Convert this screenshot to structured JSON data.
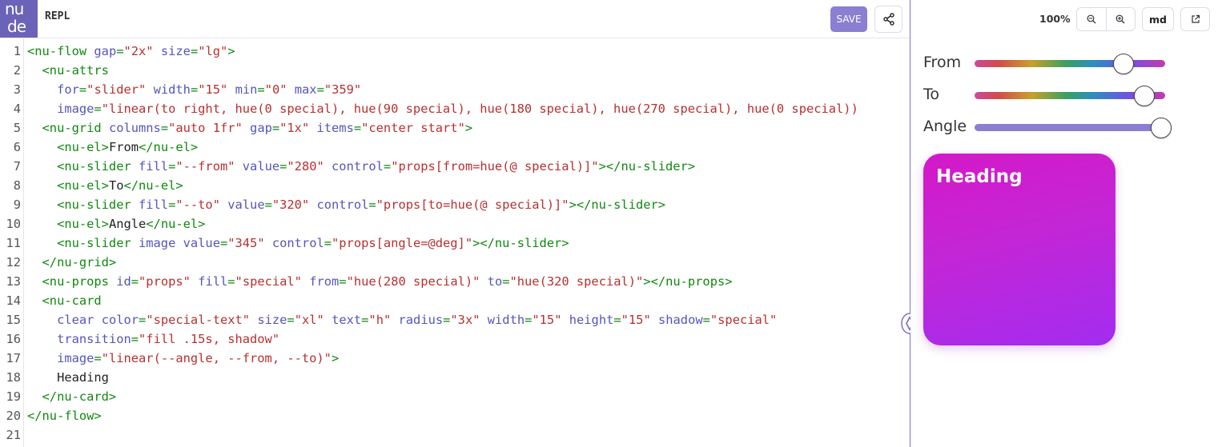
{
  "header": {
    "logo_line1": "nu",
    "logo_line2": "de",
    "title": "REPL",
    "save_label": "SAVE"
  },
  "toolbar": {
    "zoom": "100%",
    "size_label": "md"
  },
  "editor": {
    "lines": [
      [
        [
          "tag",
          "<nu-flow "
        ],
        [
          "attr",
          "gap"
        ],
        [
          "tag",
          "="
        ],
        [
          "str",
          "\"2x\""
        ],
        [
          "tag",
          " "
        ],
        [
          "attr",
          "size"
        ],
        [
          "tag",
          "="
        ],
        [
          "str",
          "\"lg\""
        ],
        [
          "tag",
          ">"
        ]
      ],
      [
        [
          "tag",
          "  <nu-attrs"
        ]
      ],
      [
        [
          "tag",
          "    "
        ],
        [
          "attr",
          "for"
        ],
        [
          "tag",
          "="
        ],
        [
          "str",
          "\"slider\""
        ],
        [
          "tag",
          " "
        ],
        [
          "attr",
          "width"
        ],
        [
          "tag",
          "="
        ],
        [
          "str",
          "\"15\""
        ],
        [
          "tag",
          " "
        ],
        [
          "attr",
          "min"
        ],
        [
          "tag",
          "="
        ],
        [
          "str",
          "\"0\""
        ],
        [
          "tag",
          " "
        ],
        [
          "attr",
          "max"
        ],
        [
          "tag",
          "="
        ],
        [
          "str",
          "\"359\""
        ]
      ],
      [
        [
          "tag",
          "    "
        ],
        [
          "attr",
          "image"
        ],
        [
          "tag",
          "="
        ],
        [
          "str",
          "\"linear(to right, hue(0 special), hue(90 special), hue(180 special), hue(270 special), hue(0 special))"
        ]
      ],
      [
        [
          "tag",
          "  <nu-grid "
        ],
        [
          "attr",
          "columns"
        ],
        [
          "tag",
          "="
        ],
        [
          "str",
          "\"auto 1fr\""
        ],
        [
          "tag",
          " "
        ],
        [
          "attr",
          "gap"
        ],
        [
          "tag",
          "="
        ],
        [
          "str",
          "\"1x\""
        ],
        [
          "tag",
          " "
        ],
        [
          "attr",
          "items"
        ],
        [
          "tag",
          "="
        ],
        [
          "str",
          "\"center start\""
        ],
        [
          "tag",
          ">"
        ]
      ],
      [
        [
          "tag",
          "    <nu-el>"
        ],
        [
          "txt",
          "From"
        ],
        [
          "tag",
          "</nu-el>"
        ]
      ],
      [
        [
          "tag",
          "    <nu-slider "
        ],
        [
          "attr",
          "fill"
        ],
        [
          "tag",
          "="
        ],
        [
          "str",
          "\"--from\""
        ],
        [
          "tag",
          " "
        ],
        [
          "attr",
          "value"
        ],
        [
          "tag",
          "="
        ],
        [
          "str",
          "\"280\""
        ],
        [
          "tag",
          " "
        ],
        [
          "attr",
          "control"
        ],
        [
          "tag",
          "="
        ],
        [
          "str",
          "\"props[from=hue(@ special)]\""
        ],
        [
          "tag",
          "></nu-slider>"
        ]
      ],
      [
        [
          "tag",
          "    <nu-el>"
        ],
        [
          "txt",
          "To"
        ],
        [
          "tag",
          "</nu-el>"
        ]
      ],
      [
        [
          "tag",
          "    <nu-slider "
        ],
        [
          "attr",
          "fill"
        ],
        [
          "tag",
          "="
        ],
        [
          "str",
          "\"--to\""
        ],
        [
          "tag",
          " "
        ],
        [
          "attr",
          "value"
        ],
        [
          "tag",
          "="
        ],
        [
          "str",
          "\"320\""
        ],
        [
          "tag",
          " "
        ],
        [
          "attr",
          "control"
        ],
        [
          "tag",
          "="
        ],
        [
          "str",
          "\"props[to=hue(@ special)]\""
        ],
        [
          "tag",
          "></nu-slider>"
        ]
      ],
      [
        [
          "tag",
          "    <nu-el>"
        ],
        [
          "txt",
          "Angle"
        ],
        [
          "tag",
          "</nu-el>"
        ]
      ],
      [
        [
          "tag",
          "    <nu-slider "
        ],
        [
          "attr",
          "image"
        ],
        [
          "tag",
          " "
        ],
        [
          "attr",
          "value"
        ],
        [
          "tag",
          "="
        ],
        [
          "str",
          "\"345\""
        ],
        [
          "tag",
          " "
        ],
        [
          "attr",
          "control"
        ],
        [
          "tag",
          "="
        ],
        [
          "str",
          "\"props[angle=@deg]\""
        ],
        [
          "tag",
          "></nu-slider>"
        ]
      ],
      [
        [
          "tag",
          "  </nu-grid>"
        ]
      ],
      [
        [
          "tag",
          "  <nu-props "
        ],
        [
          "attr",
          "id"
        ],
        [
          "tag",
          "="
        ],
        [
          "str",
          "\"props\""
        ],
        [
          "tag",
          " "
        ],
        [
          "attr",
          "fill"
        ],
        [
          "tag",
          "="
        ],
        [
          "str",
          "\"special\""
        ],
        [
          "tag",
          " "
        ],
        [
          "attr",
          "from"
        ],
        [
          "tag",
          "="
        ],
        [
          "str",
          "\"hue(280 special)\""
        ],
        [
          "tag",
          " "
        ],
        [
          "attr",
          "to"
        ],
        [
          "tag",
          "="
        ],
        [
          "str",
          "\"hue(320 special)\""
        ],
        [
          "tag",
          "></nu-props>"
        ]
      ],
      [
        [
          "tag",
          "  <nu-card"
        ]
      ],
      [
        [
          "tag",
          "    "
        ],
        [
          "attr",
          "clear"
        ],
        [
          "tag",
          " "
        ],
        [
          "attr",
          "color"
        ],
        [
          "tag",
          "="
        ],
        [
          "str",
          "\"special-text\""
        ],
        [
          "tag",
          " "
        ],
        [
          "attr",
          "size"
        ],
        [
          "tag",
          "="
        ],
        [
          "str",
          "\"xl\""
        ],
        [
          "tag",
          " "
        ],
        [
          "attr",
          "text"
        ],
        [
          "tag",
          "="
        ],
        [
          "str",
          "\"h\""
        ],
        [
          "tag",
          " "
        ],
        [
          "attr",
          "radius"
        ],
        [
          "tag",
          "="
        ],
        [
          "str",
          "\"3x\""
        ],
        [
          "tag",
          " "
        ],
        [
          "attr",
          "width"
        ],
        [
          "tag",
          "="
        ],
        [
          "str",
          "\"15\""
        ],
        [
          "tag",
          " "
        ],
        [
          "attr",
          "height"
        ],
        [
          "tag",
          "="
        ],
        [
          "str",
          "\"15\""
        ],
        [
          "tag",
          " "
        ],
        [
          "attr",
          "shadow"
        ],
        [
          "tag",
          "="
        ],
        [
          "str",
          "\"special\""
        ]
      ],
      [
        [
          "tag",
          "    "
        ],
        [
          "attr",
          "transition"
        ],
        [
          "tag",
          "="
        ],
        [
          "str",
          "\"fill .15s, shadow\""
        ]
      ],
      [
        [
          "tag",
          "    "
        ],
        [
          "attr",
          "image"
        ],
        [
          "tag",
          "="
        ],
        [
          "str",
          "\"linear(--angle, --from, --to)\""
        ],
        [
          "tag",
          ">"
        ]
      ],
      [
        [
          "txt",
          "    Heading"
        ]
      ],
      [
        [
          "tag",
          "  </nu-card>"
        ]
      ],
      [
        [
          "tag",
          "</nu-flow>"
        ]
      ],
      []
    ]
  },
  "preview": {
    "sliders": [
      {
        "label": "From",
        "value": 280,
        "min": 0,
        "max": 359
      },
      {
        "label": "To",
        "value": 320,
        "min": 0,
        "max": 359
      },
      {
        "label": "Angle",
        "value": 345,
        "min": 0,
        "max": 359
      }
    ],
    "card_heading": "Heading"
  }
}
